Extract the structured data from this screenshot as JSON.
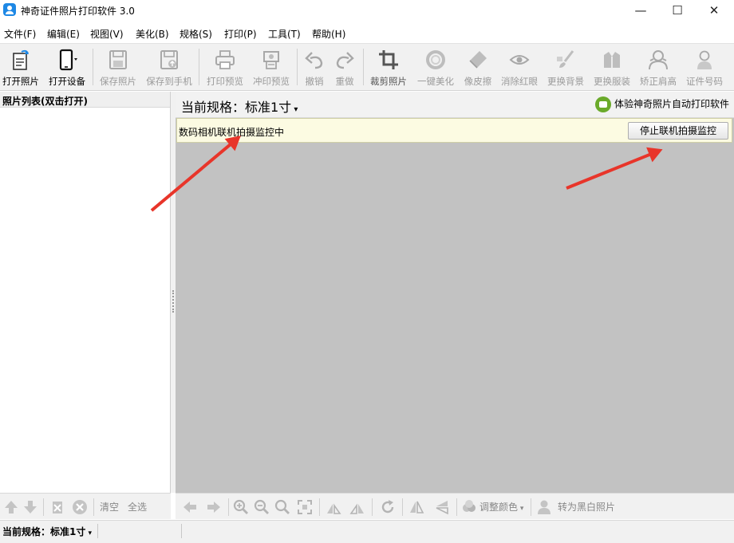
{
  "window": {
    "title": "神奇证件照片打印软件 3.0",
    "minimize": "—",
    "maximize": "☐",
    "close": "✕"
  },
  "menu": [
    "文件(F)",
    "编辑(E)",
    "视图(V)",
    "美化(B)",
    "规格(S)",
    "打印(P)",
    "工具(T)",
    "帮助(H)"
  ],
  "toolbar": {
    "open_photo": "打开照片",
    "open_device": "打开设备",
    "save_photo": "保存照片",
    "save_to_phone": "保存到手机",
    "print_preview": "打印预览",
    "develop_preview": "冲印预览",
    "undo": "撤销",
    "redo": "重做",
    "crop_photo": "裁剪照片",
    "one_key_beautify": "一键美化",
    "eraser": "像皮擦",
    "remove_redeye": "消除红眼",
    "change_background": "更换背景",
    "change_clothes": "更换服装",
    "correct_shoulders": "矫正肩高",
    "id_number": "证件号码"
  },
  "left_panel": {
    "header": "照片列表(双击打开)",
    "clear": "清空",
    "select_all": "全选"
  },
  "right_panel": {
    "current_spec": "当前规格：标准1寸",
    "promo_link": "体验神奇照片自动打印软件",
    "monitor_status": "数码相机联机拍摄监控中",
    "stop_button": "停止联机拍摄监控",
    "adjust_color": "调整颜色",
    "to_bw": "转为黑白照片"
  },
  "status": {
    "current_spec": "当前规格：标准1寸"
  },
  "colors": {
    "arrow": "#e8352a",
    "canvas": "#c2c2c2",
    "monitor_bg": "#fcfbe2"
  }
}
